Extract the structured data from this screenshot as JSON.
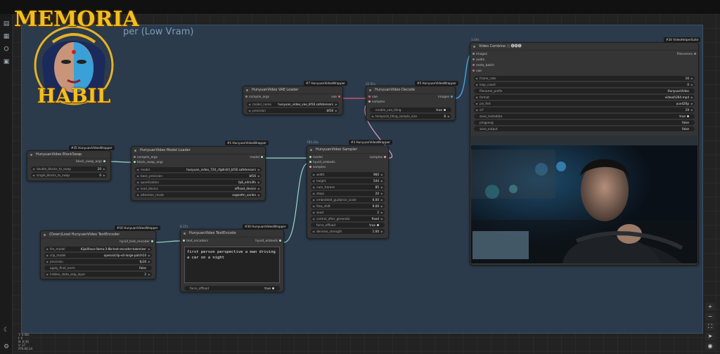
{
  "logo": {
    "title": "MEMORIA",
    "subtitle": "HABIL"
  },
  "group": {
    "title": "per (Low Vram)"
  },
  "colors": {
    "group_bg": "#2b3b4b",
    "node_bg": "#353535",
    "canvas_bg": "#222222",
    "logo_gold": "#f0c020",
    "link_green": "#9dd9c5",
    "link_pink": "#e05a7a",
    "link_blue": "#4aa3df"
  },
  "sidebar": {
    "icons": [
      "queue-icon",
      "node-library-icon",
      "model-library-icon",
      "workflows-icon",
      "theme-icon",
      "settings-icon"
    ]
  },
  "nodes": {
    "blockswap": {
      "badge": "#35 HunyuanVideoWrapper",
      "title": "HunyuanVideo BlockSwap",
      "output": "block_swap_args",
      "widgets": [
        {
          "label": "double_blocks_to_swap",
          "value": "20"
        },
        {
          "label": "single_blocks_to_swap",
          "value": "0"
        }
      ]
    },
    "model_loader": {
      "badge": "#1 HunyuanVideoWrapper",
      "title": "HunyuanVideo Model Loader",
      "inputs": [
        "compile_args",
        "block_swap_args"
      ],
      "output": "model",
      "widgets": [
        {
          "label": "model",
          "value": "hunyuan_video_720_cfgdistill_bf16.safetensors"
        },
        {
          "label": "base_precision",
          "value": "bf16"
        },
        {
          "label": "quantization",
          "value": "fp8_e4m3fn"
        },
        {
          "label": "load_device",
          "value": "offload_device"
        },
        {
          "label": "attention_mode",
          "value": "sageattn_varlen"
        }
      ]
    },
    "vae_loader": {
      "badge": "#7 HunyuanVideoWrapper",
      "title": "HunyuanVideo VAE Loader",
      "input": "compile_args",
      "output": "vae",
      "widgets": [
        {
          "label": "model_name",
          "value": "hunyuan_video_vae_bf16.safetensors"
        },
        {
          "label": "precision",
          "value": "bf16"
        }
      ]
    },
    "decode": {
      "timing": "32.81s",
      "badge": "#5 HunyuanVideoWrapper",
      "title": "HunyuanVideo Decode",
      "inputs": [
        "vae",
        "samples"
      ],
      "output": "images",
      "widgets": [
        {
          "label": "enable_vae_tiling",
          "value": "true"
        },
        {
          "label": "temporal_tiling_sample_size",
          "value": "8"
        }
      ]
    },
    "sampler": {
      "timing": "785.43s",
      "badge": "#3 HunyuanVideoWrapper",
      "title": "HunyuanVideo Sampler",
      "inputs": [
        "model",
        "hyvid_embeds",
        "samples"
      ],
      "output": "samples",
      "widgets": [
        {
          "label": "width",
          "value": "960"
        },
        {
          "label": "height",
          "value": "544"
        },
        {
          "label": "num_frames",
          "value": "85"
        },
        {
          "label": "steps",
          "value": "20"
        },
        {
          "label": "embedded_guidance_scale",
          "value": "6.00"
        },
        {
          "label": "flow_shift",
          "value": "9.00"
        },
        {
          "label": "seed",
          "value": "2"
        },
        {
          "label": "control_after_generate",
          "value": "fixed"
        },
        {
          "label": "force_offload",
          "value": "true"
        },
        {
          "label": "denoise_strength",
          "value": "1.00"
        }
      ]
    },
    "text_encoder_loader": {
      "badge": "#16 HunyuanVideoWrapper",
      "title": "(Down)Load HunyuanVideo TextEncoder",
      "output": "hyvid_text_encoder",
      "widgets": [
        {
          "label": "llm_model",
          "value": "Kijai/llava-llama-3-8b-text-encoder-tokenizer"
        },
        {
          "label": "clip_model",
          "value": "openai/clip-vit-large-patch14"
        },
        {
          "label": "precision",
          "value": "fp16"
        },
        {
          "label": "apply_final_norm",
          "value": "false"
        },
        {
          "label": "hidden_state_skip_layer",
          "value": "2"
        }
      ]
    },
    "text_encode": {
      "timing": "8.37s",
      "badge": "#30 HunyuanVideoWrapper",
      "title": "HunyuanVideo TextEncode",
      "input": "text_encoders",
      "output": "hyvid_embeds",
      "prompt": "first person perspective a man driving a car on a night",
      "widgets": [
        {
          "label": "force_offload",
          "value": "true"
        }
      ]
    },
    "video_combine": {
      "timing": "1.04s",
      "badge": "#34 VideoHelperSuite",
      "title": "Video Combine",
      "emoji": "🎥🅥🅗🅢",
      "inputs": [
        "images",
        "audio",
        "meta_batch",
        "vae"
      ],
      "output": "Filenames",
      "widgets": [
        {
          "label": "frame_rate",
          "value": "16"
        },
        {
          "label": "loop_count",
          "value": "0"
        },
        {
          "label": "filename_prefix",
          "value": "HunyuanVideo"
        },
        {
          "label": "format",
          "value": "video/h264-mp4"
        },
        {
          "label": "pix_fmt",
          "value": "yuv420p"
        },
        {
          "label": "crf",
          "value": "19"
        },
        {
          "label": "save_metadata",
          "value": "true"
        },
        {
          "label": "pingpong",
          "value": "false"
        },
        {
          "label": "save_output",
          "value": "false"
        }
      ]
    }
  },
  "canvas_controls": [
    "zoom-in-icon",
    "zoom-out-icon",
    "fit-view-icon",
    "select-mode-icon",
    "toggle-link-visibility-icon"
  ],
  "stats": [
    "T: 0.00s",
    "I: 0",
    "N: 8 [8]",
    "V: 37",
    "FPS:60.24"
  ]
}
